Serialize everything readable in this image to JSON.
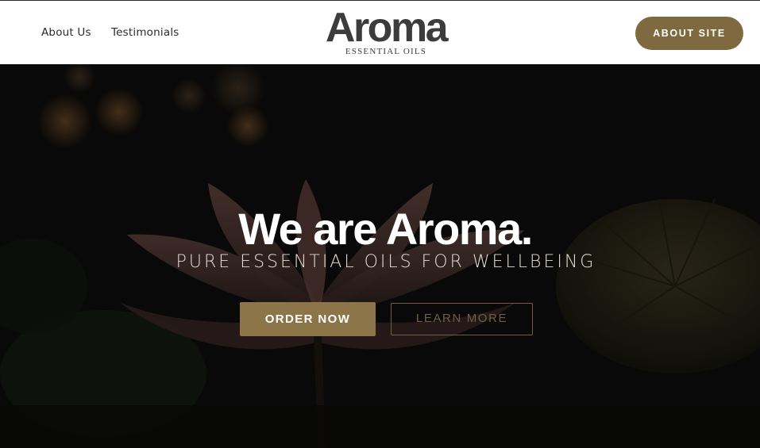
{
  "header": {
    "nav": [
      {
        "label": "About Us"
      },
      {
        "label": "Testimonials"
      }
    ],
    "logo": {
      "word": "Aroma",
      "tagline": "ESSENTIAL OILS"
    },
    "cta_label": "ABOUT SITE"
  },
  "hero": {
    "title": "We are Aroma.",
    "subtitle": "PURE ESSENTIAL OILS FOR WELLBEING",
    "primary_button": "ORDER NOW",
    "secondary_button": "LEARN MORE"
  },
  "colors": {
    "accent": "#7f6a3f",
    "primary_button": "#8c7548",
    "outline_button": "#6e5f3f",
    "hero_background": "#151311"
  }
}
